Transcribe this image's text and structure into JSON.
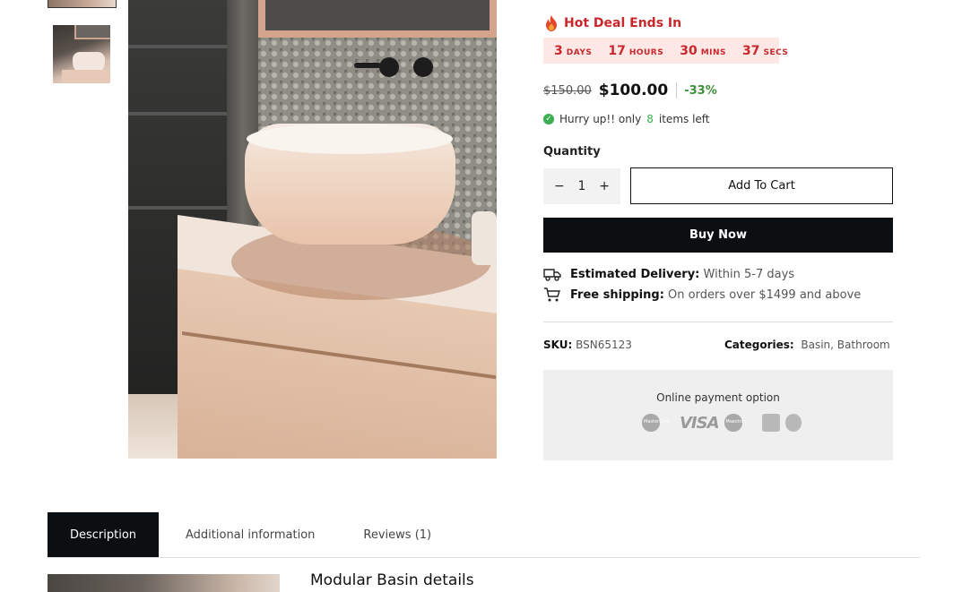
{
  "hot_deal": {
    "label": "Hot Deal Ends In"
  },
  "countdown": [
    {
      "value": "3",
      "unit": "DAYS"
    },
    {
      "value": "17",
      "unit": "HOURS"
    },
    {
      "value": "30",
      "unit": "MINS"
    },
    {
      "value": "37",
      "unit": "SECS"
    }
  ],
  "price": {
    "old": "$150.00",
    "current": "$100.00",
    "discount": "-33%"
  },
  "stock": {
    "prefix": "Hurry up!! only",
    "count": "8",
    "suffix": "items left"
  },
  "quantity": {
    "label": "Quantity",
    "value": "1",
    "minus": "−",
    "plus": "+"
  },
  "actions": {
    "add_to_cart": "Add To Cart",
    "buy_now": "Buy Now"
  },
  "delivery": {
    "label": "Estimated Delivery:",
    "text": "Within 5-7 days"
  },
  "shipping": {
    "label": "Free shipping:",
    "text": "On orders over $1499 and above"
  },
  "meta": {
    "sku_label": "SKU:",
    "sku": "BSN65123",
    "categories_label": "Categories:",
    "categories": [
      "Basin",
      "Bathroom"
    ]
  },
  "payment": {
    "title": "Online payment option",
    "mastercard": "MasterCard",
    "visa": "VISA",
    "maestro": "Maestro"
  },
  "tabs": [
    {
      "label": "Description",
      "active": true
    },
    {
      "label": "Additional information",
      "active": false
    },
    {
      "label": "Reviews (1)",
      "active": false
    }
  ],
  "description": {
    "title": "Modular Basin details"
  },
  "colors": {
    "accent_red": "#c9272b",
    "success_green": "#3cae50",
    "dark": "#0b0f12"
  }
}
